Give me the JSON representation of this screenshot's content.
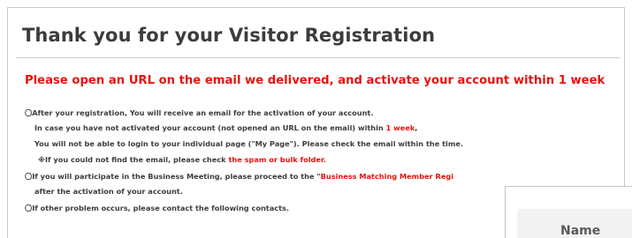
{
  "header": {
    "title": "Thank you for your Visitor Registration"
  },
  "notice": {
    "headline": "Please open an URL on the email we delivered, and activate your account within 1 week"
  },
  "info": {
    "l1": "〇After your registration, You will receive an email for the activation of your account.",
    "l2_a": "In case you have not activated your account (not opened an URL on the email) within ",
    "l2_red": "1 week",
    "l2_b": ",",
    "l3": "You will not be able to login to your individual page (\"My Page\"). Please check the email within the time.",
    "l4_a": "※If you could not find the email, please check ",
    "l4_red": "the spam or bulk folder.",
    "l5_a": "〇If you will participate in the Business Meeting, please proceed to the \"",
    "l5_red": "Business Matching Member Regi",
    "l6": "after the activation of your account.",
    "l7": "〇If other problem occurs, please contact the following contacts."
  },
  "form": {
    "name_label": "Name"
  }
}
